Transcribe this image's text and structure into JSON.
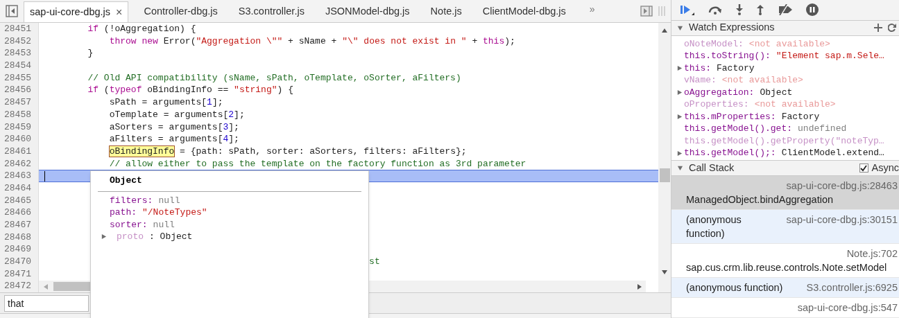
{
  "tabs": [
    {
      "label": "sap-ui-core-dbg.js",
      "selected": true,
      "close": "×"
    },
    {
      "label": "Controller-dbg.js",
      "selected": false
    },
    {
      "label": "S3.controller.js",
      "selected": false
    },
    {
      "label": "JSONModel-dbg.js",
      "selected": false
    },
    {
      "label": "Note.js",
      "selected": false
    },
    {
      "label": "ClientModel-dbg.js",
      "selected": false
    }
  ],
  "tab_overflow": "»",
  "code": [
    {
      "number": "28451",
      "current": false,
      "tokens": [
        {
          "kind": "keyword",
          "text": "        if"
        },
        {
          "kind": "plain",
          "text": " (!oAggregation) {"
        }
      ]
    },
    {
      "number": "28452",
      "current": false,
      "tokens": [
        {
          "kind": "keyword",
          "text": "            throw new"
        },
        {
          "kind": "plain",
          "text": " Error("
        },
        {
          "kind": "string",
          "text": "\"Aggregation \\\"\""
        },
        {
          "kind": "plain",
          "text": " + sName + "
        },
        {
          "kind": "string",
          "text": "\"\\\" does not exist in \""
        },
        {
          "kind": "plain",
          "text": " + "
        },
        {
          "kind": "keyword",
          "text": "this"
        },
        {
          "kind": "plain",
          "text": ");"
        }
      ]
    },
    {
      "number": "28453",
      "current": false,
      "tokens": [
        {
          "kind": "plain",
          "text": "        }"
        }
      ]
    },
    {
      "number": "28454",
      "current": false
    },
    {
      "number": "28455",
      "current": false,
      "tokens": [
        {
          "kind": "comment",
          "text": "        // Old API compatibility (sName, sPath, oTemplate, oSorter, aFilters)"
        }
      ]
    },
    {
      "number": "28456",
      "current": false,
      "tokens": [
        {
          "kind": "keyword",
          "text": "        if"
        },
        {
          "kind": "plain",
          "text": " ("
        },
        {
          "kind": "keyword",
          "text": "typeof"
        },
        {
          "kind": "plain",
          "text": " oBindingInfo == "
        },
        {
          "kind": "string",
          "text": "\"string\""
        },
        {
          "kind": "plain",
          "text": ") {"
        }
      ]
    },
    {
      "number": "28457",
      "current": false,
      "tokens": [
        {
          "kind": "plain",
          "text": "            sPath = arguments["
        },
        {
          "kind": "number",
          "text": "1"
        },
        {
          "kind": "plain",
          "text": "];"
        }
      ]
    },
    {
      "number": "28458",
      "current": false,
      "tokens": [
        {
          "kind": "plain",
          "text": "            oTemplate = arguments["
        },
        {
          "kind": "number",
          "text": "2"
        },
        {
          "kind": "plain",
          "text": "];"
        }
      ]
    },
    {
      "number": "28459",
      "current": false,
      "tokens": [
        {
          "kind": "plain",
          "text": "            aSorters = arguments["
        },
        {
          "kind": "number",
          "text": "3"
        },
        {
          "kind": "plain",
          "text": "];"
        }
      ]
    },
    {
      "number": "28460",
      "current": false,
      "tokens": [
        {
          "kind": "plain",
          "text": "            aFilters = arguments["
        },
        {
          "kind": "number",
          "text": "4"
        },
        {
          "kind": "plain",
          "text": "];"
        }
      ]
    },
    {
      "number": "28461",
      "current": false,
      "tokens": [
        {
          "kind": "highlight",
          "text": "            oBindingInfo"
        },
        {
          "kind": "plain",
          "text": " = {path: sPath, sorter: aSorters, filters: aFilters};"
        }
      ]
    },
    {
      "number": "28462",
      "current": false,
      "tokens": [
        {
          "kind": "comment",
          "text": "            // allow either to pass the template on the factory function as 3rd parameter"
        }
      ]
    },
    {
      "number": "28463",
      "current": true
    },
    {
      "number": "28464",
      "current": false
    },
    {
      "number": "28465",
      "current": false
    },
    {
      "number": "28466",
      "current": false
    },
    {
      "number": "28467",
      "current": false
    },
    {
      "number": "28468",
      "current": false
    },
    {
      "number": "28469",
      "current": false
    },
    {
      "number": "28470",
      "current": false,
      "tokens": [
        {
          "kind": "comment",
          "text": "                                                            st"
        }
      ]
    },
    {
      "number": "28471",
      "current": false
    },
    {
      "number": "28472",
      "current": false
    }
  ],
  "popover": {
    "title": "Object",
    "properties": [
      {
        "name": "filters:",
        "value": "null",
        "kind": "null",
        "expandable": false
      },
      {
        "name": "path:",
        "value": "\"/NoteTypes\"",
        "kind": "string",
        "expandable": false
      },
      {
        "name": "sorter:",
        "value": "null",
        "kind": "null",
        "expandable": false
      },
      {
        "name": "proto",
        "value": ": Object",
        "kind": "internal",
        "expandable": true
      }
    ]
  },
  "search": {
    "value": "that"
  },
  "watch": {
    "title": "Watch Expressions",
    "items": [
      {
        "name": "oNoteModel:",
        "value": "<not available>",
        "kind": "unavailable",
        "expandable": false
      },
      {
        "name": "this.toString():",
        "value": "\"Element sap.m.Sele…",
        "kind": "string",
        "expandable": false
      },
      {
        "name": "this:",
        "value": "Factory",
        "kind": "object",
        "expandable": true
      },
      {
        "name": "vName:",
        "value": "<not available>",
        "kind": "unavailable",
        "expandable": false
      },
      {
        "name": "oAggregation:",
        "value": "Object",
        "kind": "object",
        "expandable": true
      },
      {
        "name": "oProperties:",
        "value": "<not available>",
        "kind": "unavailable",
        "expandable": false
      },
      {
        "name": "this.mProperties:",
        "value": "Factory",
        "kind": "object",
        "expandable": true
      },
      {
        "name": "this.getModel().get:",
        "value": "undefined",
        "kind": "undefined",
        "expandable": false
      },
      {
        "name": "this.getModel().getProperty(\"noteTyp…",
        "kind": "pending",
        "expandable": false
      },
      {
        "name": "this.getModel();:",
        "value": "ClientModel.extend…",
        "kind": "object",
        "expandable": true
      }
    ]
  },
  "call_stack": {
    "title": "Call Stack",
    "async": {
      "label": "Async",
      "checked": true
    },
    "frames": [
      {
        "kind": "stacked",
        "function": "ManagedObject.bindAggregation",
        "location": "sap-ui-core-dbg.js:28463",
        "selected": true
      },
      {
        "kind": "inline",
        "function": "(anonymous function)",
        "location": "sap-ui-core-dbg.js:30151",
        "selected": false
      },
      {
        "kind": "stacked",
        "function": "sap.cus.crm.lib.reuse.controls.Note.setModel",
        "location": "Note.js:702",
        "selected": false
      },
      {
        "kind": "inline",
        "function": "(anonymous function)",
        "location": "S3.controller.js:6925",
        "selected": false
      },
      {
        "kind": "stacked",
        "location": "sap-ui-core-dbg.js:547",
        "selected": false
      }
    ]
  }
}
